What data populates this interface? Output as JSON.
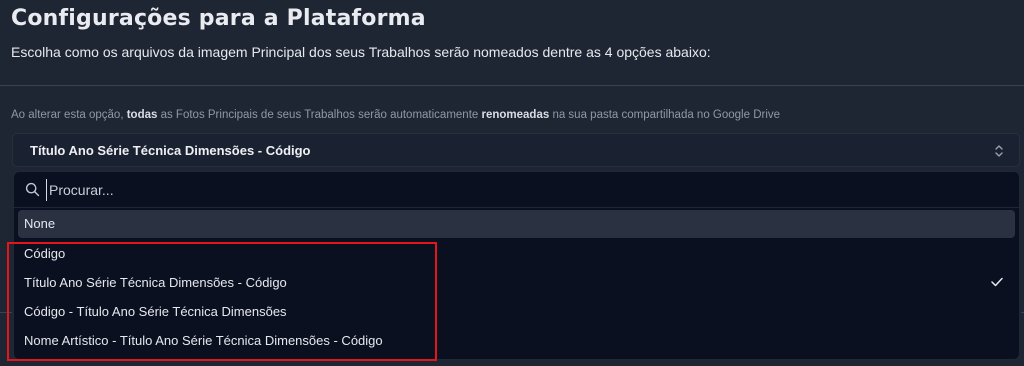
{
  "page": {
    "title": "Configurações para a Plataforma",
    "subtitle": "Escolha como os arquivos da imagem Principal dos seus Trabalhos serão nomeados dentre as 4 opções abaixo:"
  },
  "notice": {
    "part1": "Ao alterar esta opção, ",
    "bold1": "todas",
    "part2": " as Fotos Principais de seus Trabalhos serão automaticamente ",
    "bold2": "renomeadas",
    "part3": " na sua pasta compartilhada no Google Drive"
  },
  "select": {
    "value": "Título Ano Série Técnica Dimensões - Código",
    "icon": "chevron-up-down-icon"
  },
  "dropdown": {
    "search_placeholder": "Procurar...",
    "search_value": "",
    "options": [
      {
        "label": "None",
        "highlighted": true,
        "selected": false
      },
      {
        "label": "Código",
        "highlighted": false,
        "selected": false
      },
      {
        "label": "Título Ano Série Técnica Dimensões - Código",
        "highlighted": false,
        "selected": true
      },
      {
        "label": "Código - Título Ano Série Técnica Dimensões",
        "highlighted": false,
        "selected": false
      },
      {
        "label": "Nome Artístico - Título Ano Série Técnica Dimensões - Código",
        "highlighted": false,
        "selected": false
      }
    ]
  },
  "colors": {
    "background": "#1f2633",
    "dropdown_bg": "#0b1020",
    "annotation_red": "#e3161b"
  }
}
